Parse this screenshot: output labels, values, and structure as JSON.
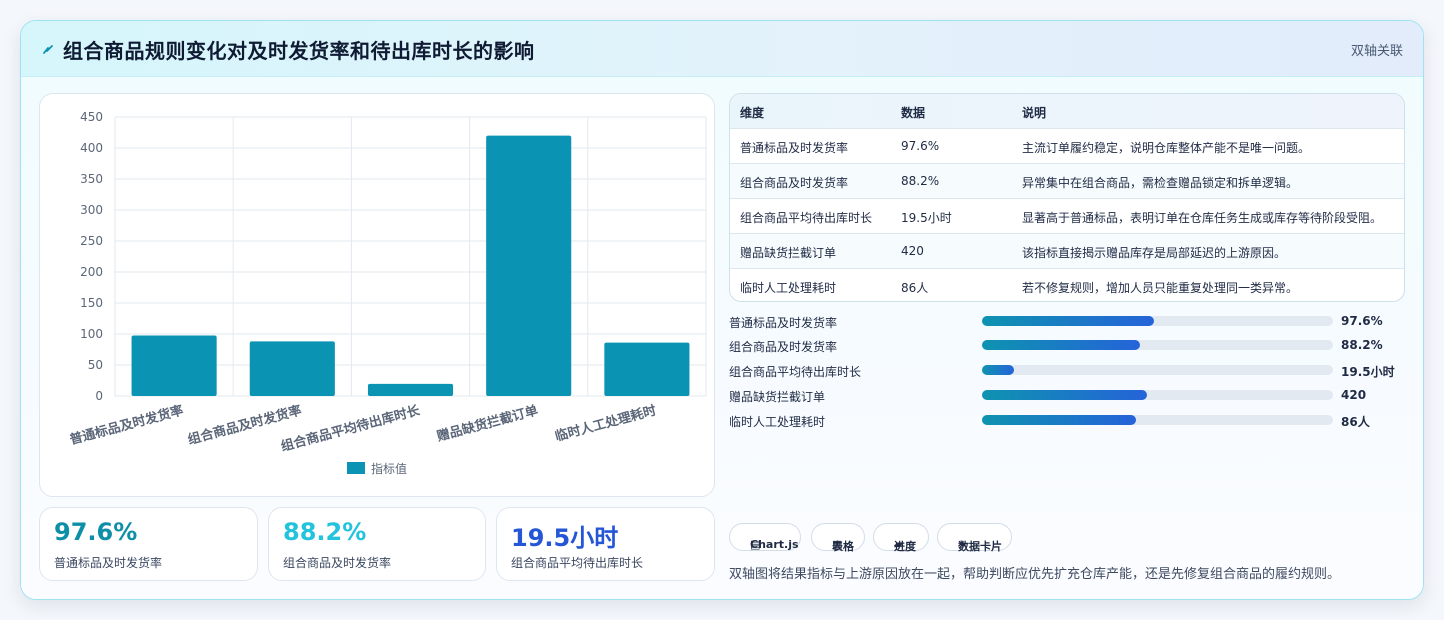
{
  "header": {
    "title": "组合商品规则变化对及时发货率和待出库时长的影响",
    "tag": "双轴关联"
  },
  "chart_data": {
    "type": "bar",
    "categories": [
      "普通标品及时发货率",
      "组合商品及时发货率",
      "组合商品平均待出库时长",
      "赠品缺货拦截订单",
      "临时人工处理耗时"
    ],
    "series": [
      {
        "name": "指标值",
        "values": [
          97.6,
          88.2,
          19.5,
          420,
          86
        ]
      }
    ],
    "ylim": [
      0,
      450
    ],
    "yticks": [
      0,
      50,
      100,
      150,
      200,
      250,
      300,
      350,
      400,
      450
    ],
    "grid": true,
    "legend": "bottom",
    "bar_color": "#0a93b3"
  },
  "kpis": [
    {
      "value": "97.6%",
      "label": "普通标品及时发货率",
      "color": "#0e8fa8"
    },
    {
      "value": "88.2%",
      "label": "组合商品及时发货率",
      "color": "#22c3dc"
    },
    {
      "value": "19.5小时",
      "label": "组合商品平均待出库时长",
      "color": "#2456d6"
    }
  ],
  "table": {
    "headers": [
      "维度",
      "数据",
      "说明"
    ],
    "rows": [
      [
        "普通标品及时发货率",
        "97.6%",
        "主流订单履约稳定，说明仓库整体产能不是唯一问题。"
      ],
      [
        "组合商品及时发货率",
        "88.2%",
        "异常集中在组合商品，需检查赠品锁定和拆单逻辑。"
      ],
      [
        "组合商品平均待出库时长",
        "19.5小时",
        "显著高于普通标品，表明订单在仓库任务生成或库存等待阶段受阻。"
      ],
      [
        "赠品缺货拦截订单",
        "420",
        "该指标直接揭示赠品库存是局部延迟的上游原因。"
      ],
      [
        "临时人工处理耗时",
        "86人",
        "若不修复规则，增加人员只能重复处理同一类异常。"
      ]
    ]
  },
  "progress": [
    {
      "label": "普通标品及时发货率",
      "value": "97.6%",
      "fill": 0.49
    },
    {
      "label": "组合商品及时发货率",
      "value": "88.2%",
      "fill": 0.45
    },
    {
      "label": "组合商品平均待出库时长",
      "value": "19.5小时",
      "fill": 0.09
    },
    {
      "label": "赠品缺货拦截订单",
      "value": "420",
      "fill": 0.47
    },
    {
      "label": "临时人工处理耗时",
      "value": "86人",
      "fill": 0.44
    }
  ],
  "chips": [
    {
      "icon": "chart-icon",
      "label": "Chart.js"
    },
    {
      "icon": "table-icon",
      "label": "表格"
    },
    {
      "icon": "progress-icon",
      "label": "进度"
    },
    {
      "icon": "sparkle-icon",
      "label": "数据卡片"
    }
  ],
  "note": "双轴图将结果指标与上游原因放在一起，帮助判断应优先扩充仓库产能，还是先修复组合商品的履约规则。"
}
